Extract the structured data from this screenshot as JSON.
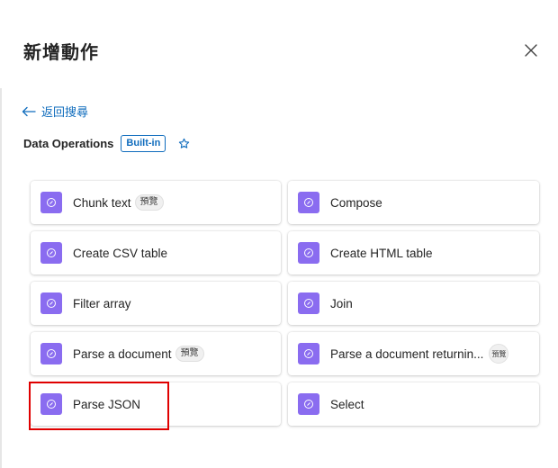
{
  "header": {
    "title": "新增動作",
    "close_icon": "close-icon"
  },
  "nav": {
    "back_label": "返回搜尋",
    "back_icon": "arrow-left-icon"
  },
  "section": {
    "title": "Data Operations",
    "badge": "Built-in",
    "favorite_icon": "star-outline-icon"
  },
  "actions": [
    {
      "label": "Chunk text",
      "tag": "預覽",
      "icon": "data-operations-icon"
    },
    {
      "label": "Compose",
      "tag": "",
      "icon": "data-operations-icon"
    },
    {
      "label": "Create CSV table",
      "tag": "",
      "icon": "data-operations-icon"
    },
    {
      "label": "Create HTML table",
      "tag": "",
      "icon": "data-operations-icon"
    },
    {
      "label": "Filter array",
      "tag": "",
      "icon": "data-operations-icon"
    },
    {
      "label": "Join",
      "tag": "",
      "icon": "data-operations-icon"
    },
    {
      "label": "Parse a document",
      "tag": "預覽",
      "icon": "data-operations-icon"
    },
    {
      "label": "Parse a document returnin...",
      "tag": "預覽",
      "icon": "data-operations-icon"
    },
    {
      "label": "Parse JSON",
      "tag": "",
      "icon": "data-operations-icon"
    },
    {
      "label": "Select",
      "tag": "",
      "icon": "data-operations-icon"
    }
  ],
  "colors": {
    "accent": "#0f6cbd",
    "action_icon_bg": "#8a6cf0",
    "highlight": "#e00000"
  }
}
